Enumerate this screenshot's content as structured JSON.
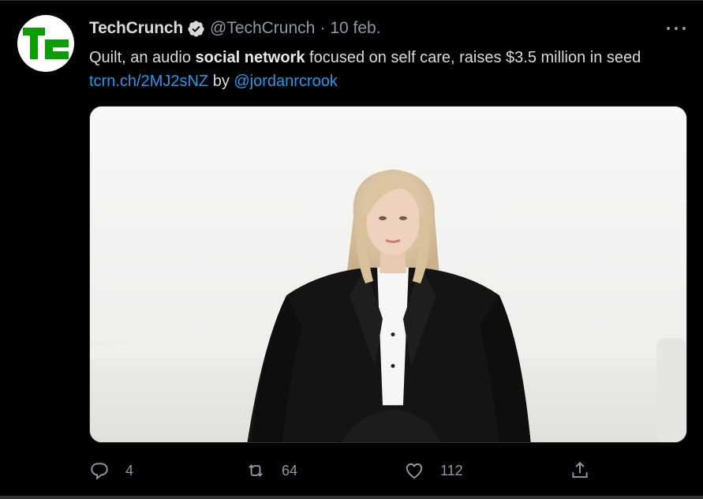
{
  "tweet": {
    "author": {
      "display_name": "TechCrunch",
      "handle": "@TechCrunch",
      "verified": true,
      "avatar_text": "TC"
    },
    "separator": "·",
    "date": "10 feb.",
    "text": {
      "part1": "Quilt, an audio ",
      "bold": "social network",
      "part2": " focused on self care, raises $3.5 million in seed ",
      "link": "tcrn.ch/2MJ2sNZ",
      "part3": " by ",
      "mention": "@jordanrcrook"
    },
    "media_description": "photo",
    "actions": {
      "reply_count": "4",
      "retweet_count": "64",
      "like_count": "112"
    }
  },
  "colors": {
    "background": "#000000",
    "text": "#d9d9d9",
    "secondary": "#8b98a5",
    "link": "#1d9bf0",
    "brand_green": "#0a9e01"
  },
  "icons": {
    "more": "more-icon",
    "verified": "verified-badge-icon",
    "reply": "reply-icon",
    "retweet": "retweet-icon",
    "like": "heart-icon",
    "share": "share-icon"
  }
}
